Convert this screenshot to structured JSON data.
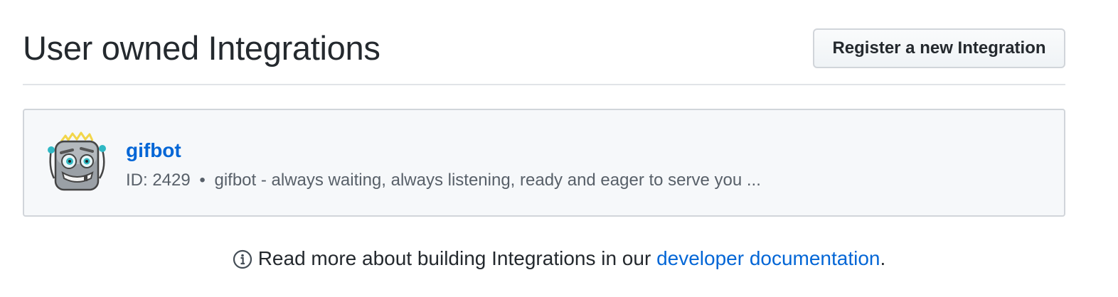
{
  "header": {
    "title": "User owned Integrations",
    "register_button_label": "Register a new Integration"
  },
  "integrations": [
    {
      "name": "gifbot",
      "id_label": "ID: 2429",
      "separator": "•",
      "description": "gifbot - always waiting, always listening, ready and eager to serve you ...",
      "avatar_icon": "gifbot-robot-avatar"
    }
  ],
  "footer": {
    "icon": "info-icon",
    "text_before": "Read more about building Integrations in our",
    "link_text": "developer documentation",
    "text_after": "."
  },
  "colors": {
    "link": "#0366d6",
    "text": "#24292e",
    "muted": "#586069",
    "box_bg": "#f6f8fa",
    "border": "#d1d5da"
  }
}
